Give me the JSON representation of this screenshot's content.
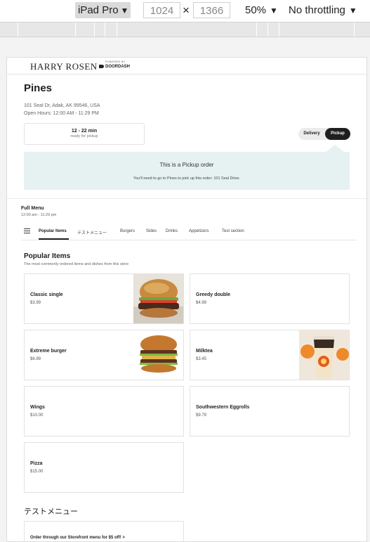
{
  "devtools": {
    "device": "iPad Pro",
    "width": "1024",
    "height": "1366",
    "separator": "×",
    "zoom": "50%",
    "throttling": "No throttling"
  },
  "header": {
    "brand": "HARRY ROSEN",
    "powered_by": "POWERED BY",
    "partner": "DOORDASH"
  },
  "store": {
    "name": "Pines",
    "address": "101 Seal Dr, Adak, AK 99546, USA",
    "hours": "Open Hours: 12:00 AM - 11:29 PM"
  },
  "eta": {
    "time": "12 - 22 min",
    "note": "ready for pickup"
  },
  "mode_toggle": {
    "delivery": "Delivery",
    "pickup": "Pickup",
    "selected": "pickup"
  },
  "pickup_banner": {
    "title": "This is a Pickup order",
    "description": "You'll need to go to Pines to pick up this order: 101 Seal Drive."
  },
  "menu": {
    "name": "Full Menu",
    "hours": "12:00 am - 11:29 pm",
    "tabs": [
      "Popular Items",
      "テストメニュー",
      "Burgers",
      "Sides",
      "Drinks",
      "Appetizers",
      "Test section"
    ],
    "active_tab": "Popular Items"
  },
  "popular": {
    "title": "Popular Items",
    "subtitle": "The most commonly ordered items and dishes from this store",
    "items": [
      {
        "name": "Classic single",
        "price": "$3.99",
        "image": "burger-photo"
      },
      {
        "name": "Greedy double",
        "price": "$4.99",
        "image": ""
      },
      {
        "name": "Extreme burger",
        "price": "$6.99",
        "image": "double-burger-photo"
      },
      {
        "name": "Milktea",
        "price": "$3.45",
        "image": "milk-tea-photo"
      },
      {
        "name": "Wings",
        "price": "$10.00",
        "image": ""
      },
      {
        "name": "Southwestern Eggrolls",
        "price": "$9.79",
        "image": ""
      },
      {
        "name": "Pizza",
        "price": "$15.00",
        "image": ""
      }
    ]
  },
  "second_section": {
    "title": "テストメニュー",
    "promo": "Order through our Storefront menu for $5 off! >"
  }
}
